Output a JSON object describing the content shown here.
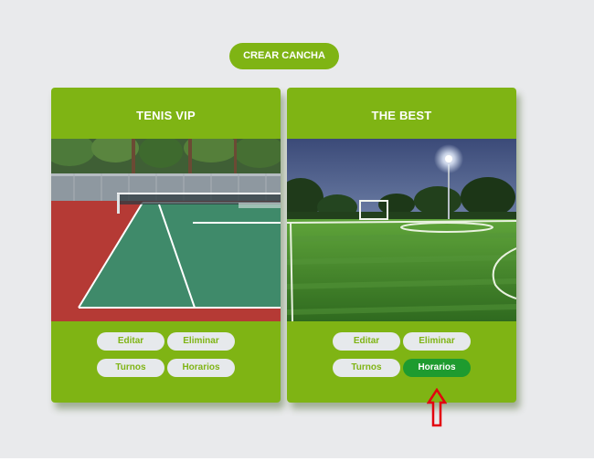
{
  "header": {
    "create_button_label": "CREAR CANCHA"
  },
  "courts": [
    {
      "title": "TENIS VIP",
      "image_icon": "tennis-court-photo",
      "buttons": {
        "edit": "Editar",
        "delete": "Eliminar",
        "shifts": "Turnos",
        "schedules": "Horarios"
      }
    },
    {
      "title": "THE BEST",
      "image_icon": "soccer-field-photo",
      "buttons": {
        "edit": "Editar",
        "delete": "Eliminar",
        "shifts": "Turnos",
        "schedules": "Horarios"
      }
    }
  ],
  "colors": {
    "page_background": "#e9eaec",
    "accent_green": "#7fb414",
    "active_button": "#1e9b2f",
    "button_background": "#e6e9ec",
    "arrow_red": "#e3000f"
  },
  "annotation": {
    "icon": "red-up-arrow-icon"
  }
}
